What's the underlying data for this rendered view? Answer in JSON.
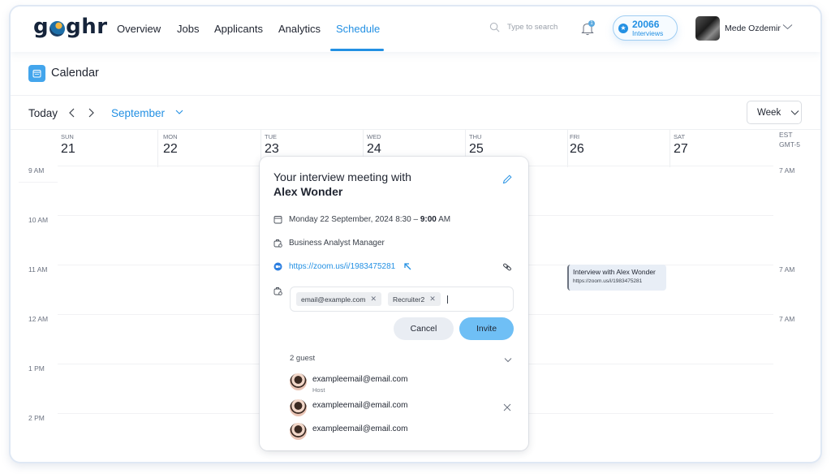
{
  "app": {
    "logo_text_left": "g",
    "logo_text_right": "ghr"
  },
  "nav": {
    "items": [
      {
        "label": "Overview",
        "active": false
      },
      {
        "label": "Jobs",
        "active": false
      },
      {
        "label": "Applicants",
        "active": false
      },
      {
        "label": "Analytics",
        "active": false
      },
      {
        "label": "Schedule",
        "active": true
      }
    ],
    "search_placeholder": "Type to search",
    "notification_count": "1",
    "interviews_count": "20066",
    "interviews_label": "Interviews",
    "user_name": "Mede Ozdemir"
  },
  "calendar": {
    "title": "Calendar",
    "today_label": "Today",
    "month": "September",
    "view": "Week",
    "timezone_line1": "EST",
    "timezone_line2": "GMT-5",
    "days": [
      {
        "dow": "SUN",
        "num": "21"
      },
      {
        "dow": "MON",
        "num": "22"
      },
      {
        "dow": "TUE",
        "num": "23"
      },
      {
        "dow": "WED",
        "num": "24"
      },
      {
        "dow": "THU",
        "num": "25"
      },
      {
        "dow": "FRI",
        "num": "26"
      },
      {
        "dow": "SAT",
        "num": "27"
      }
    ],
    "hours_left": [
      "9 AM",
      "10 AM",
      "11 AM",
      "12 AM",
      "1 PM",
      "2 PM"
    ],
    "hours_right": [
      "7 AM",
      "7 AM",
      "7 AM"
    ],
    "event": {
      "title": "Interview with Alex Wonder",
      "link": "https://zoom.us/i/1983475281",
      "day": "FRI",
      "time": "11 AM"
    }
  },
  "popover": {
    "title_line1": "Your interview meeting with",
    "title_line2": "Alex Wonder",
    "date": "Monday 22 September, 2024",
    "time_start": "8:30",
    "time_sep": " – ",
    "time_end": "9:00",
    "time_suffix": "AM",
    "position": "Business Analyst Manager",
    "zoom_link": "https://zoom.us/i/1983475281",
    "chips": [
      "email@example.com",
      "Recruiter2"
    ],
    "cancel_label": "Cancel",
    "invite_label": "Invite",
    "guest_count": "2 guest",
    "guests": [
      {
        "email": "exampleemail@email.com",
        "role": "Host"
      },
      {
        "email": "exampleemail@email.com",
        "role": ""
      },
      {
        "email": "exampleemail@email.com",
        "role": ""
      }
    ]
  },
  "colors": {
    "accent": "#2390e3",
    "invite_button": "#6fbff5",
    "cancel_button": "#e9edf3",
    "event_bg": "#e8eef6"
  }
}
